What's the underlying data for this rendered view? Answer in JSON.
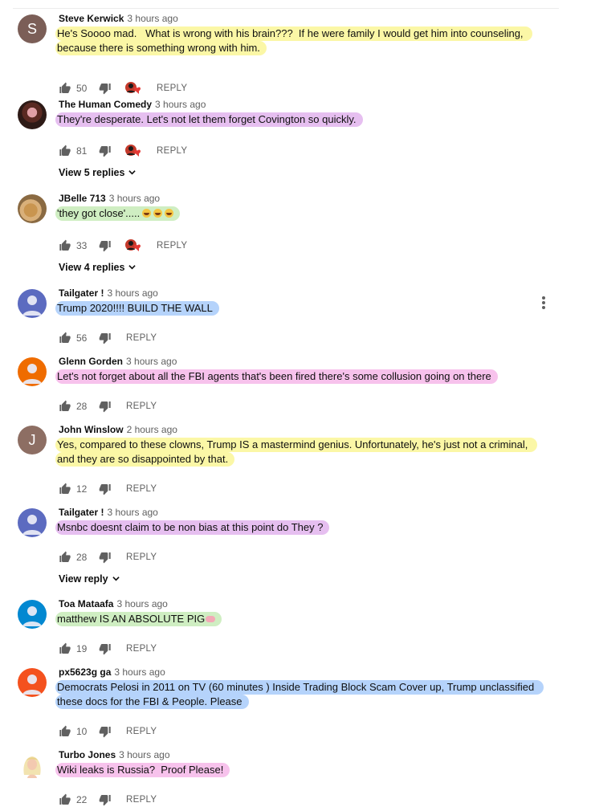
{
  "reply_label": "REPLY",
  "comments": [
    {
      "author": "Steve Kerwick",
      "time": "3 hours ago",
      "avatar": {
        "type": "letter",
        "letter": "S",
        "color": "#7b5e57"
      },
      "text": "He's Soooo mad.   What is wrong with his brain???  If he were family I would get him into counseling, because there is something wrong with him.",
      "highlight": "yellow",
      "likes": "50",
      "creator_heart": true
    },
    {
      "author": "The Human Comedy",
      "time": "3 hours ago",
      "avatar": {
        "type": "photo-dark"
      },
      "text": "They're desperate. Let's not let them forget Covington so quickly.",
      "highlight": "purple",
      "likes": "81",
      "creator_heart": true,
      "view_replies": "View 5 replies"
    },
    {
      "author": "JBelle 713",
      "time": "3 hours ago",
      "avatar": {
        "type": "photo-dog"
      },
      "text": "'they got close'.....",
      "emoji": [
        "laughing-emoji",
        "laughing-emoji",
        "laughing-emoji"
      ],
      "highlight": "green",
      "likes": "33",
      "creator_heart": true,
      "view_replies": "View 4 replies"
    },
    {
      "author": "Tailgater !",
      "time": "3 hours ago",
      "avatar": {
        "type": "person",
        "color": "#5c6bc0"
      },
      "text": "Trump 2020!!!! BUILD THE WALL",
      "highlight": "blue",
      "likes": "56",
      "creator_heart": false
    },
    {
      "author": "Glenn Gorden",
      "time": "3 hours ago",
      "avatar": {
        "type": "person",
        "color": "#ef6c00"
      },
      "text": "Let's not forget about all the FBI agents that's been fired there's some collusion going on there",
      "highlight": "pink",
      "likes": "28",
      "creator_heart": false
    },
    {
      "author": "John Winslow",
      "time": "2 hours ago",
      "avatar": {
        "type": "letter",
        "letter": "J",
        "color": "#8d6e63"
      },
      "text": "Yes, compared to these clowns, Trump IS a mastermind genius. Unfortunately, he's just not a criminal, and they are so disappointed by that.",
      "highlight": "yellow",
      "likes": "12",
      "creator_heart": false
    },
    {
      "author": "Tailgater !",
      "time": "3 hours ago",
      "avatar": {
        "type": "person",
        "color": "#5c6bc0"
      },
      "text": "Msnbc doesnt claim to be non bias at this point do They ?",
      "highlight": "purple",
      "likes": "28",
      "creator_heart": false,
      "view_replies": "View reply"
    },
    {
      "author": "Toa Mataafa",
      "time": "3 hours ago",
      "avatar": {
        "type": "person",
        "color": "#0288d1"
      },
      "text": "matthew IS AN ABSOLUTE PIG",
      "emoji": [
        "pig-nose-emoji"
      ],
      "highlight": "green",
      "likes": "19",
      "creator_heart": false
    },
    {
      "author": "px5623g ga",
      "time": "3 hours ago",
      "avatar": {
        "type": "person",
        "color": "#f4511e"
      },
      "text": "Democrats Pelosi in 2011 on TV (60 minutes ) Inside Trading Block Scam Cover up, Trump unclassified these docs for the FBI & People. Please",
      "highlight": "blue",
      "likes": "10",
      "creator_heart": false
    },
    {
      "author": "Turbo Jones",
      "time": "3 hours ago",
      "avatar": {
        "type": "photo-blonde"
      },
      "text": "Wiki leaks is Russia?  Proof Please!",
      "highlight": "pink",
      "likes": "22",
      "creator_heart": false
    }
  ]
}
